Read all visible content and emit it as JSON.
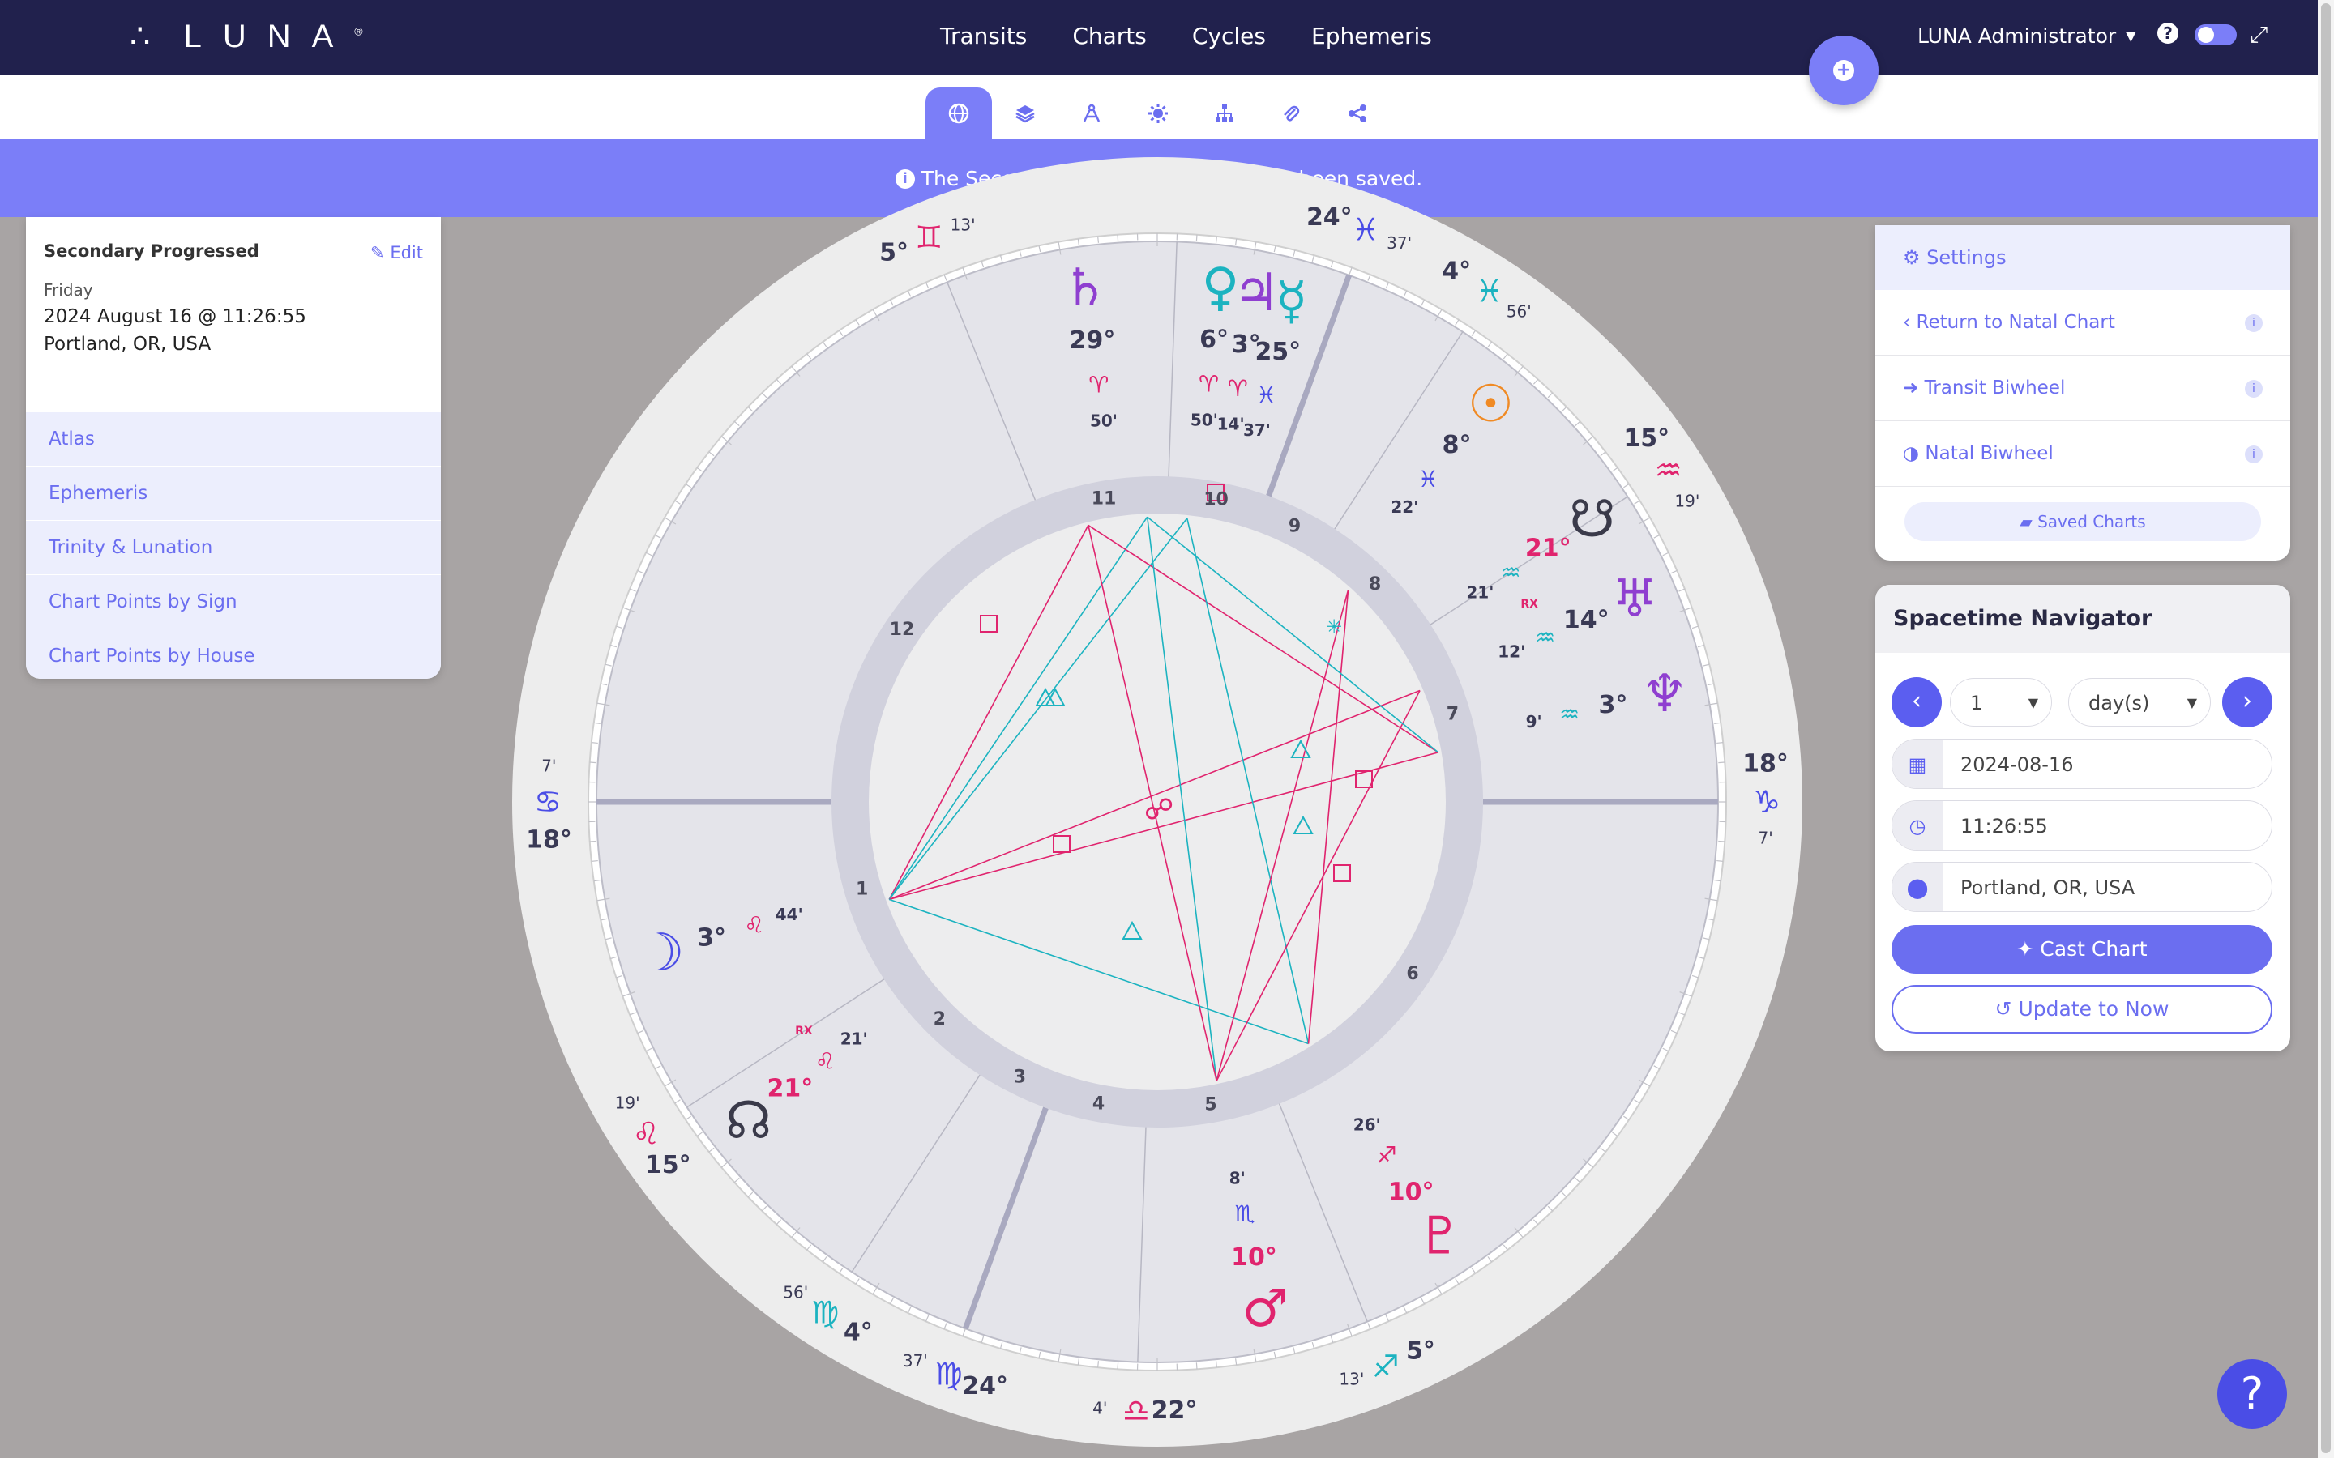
{
  "app": {
    "logo": "LUNA",
    "nav": [
      "Transits",
      "Charts",
      "Cycles",
      "Ephemeris"
    ],
    "user": "LUNA Administrator",
    "help_glyph": "?",
    "fab_glyph": "+"
  },
  "subtabs": [
    "globe-icon",
    "layers-icon",
    "compass-icon",
    "sun-icon",
    "hierarchy-icon",
    "paperclip-icon",
    "share-icon"
  ],
  "alert": {
    "icon": "i",
    "text": "The Secondary Progressed chart has been saved."
  },
  "left_panel": {
    "title": "Secondary Progressed",
    "edit": "Edit",
    "day": "Friday",
    "datetime": "2024 August 16 @ 11:26:55",
    "place": "Portland, OR, USA",
    "items": [
      "Atlas",
      "Ephemeris",
      "Trinity & Lunation",
      "Chart Points by Sign",
      "Chart Points by House"
    ]
  },
  "settings_panel": {
    "head": "Settings",
    "items": [
      "Return to Natal Chart",
      "Transit Biwheel",
      "Natal Biwheel"
    ],
    "saved": "Saved Charts"
  },
  "navigator": {
    "title": "Spacetime Navigator",
    "step": "1",
    "unit": "day(s)",
    "date": "2024-08-16",
    "time": "11:26:55",
    "place": "Portland, OR, USA",
    "cast": "Cast Chart",
    "update": "Update to Now",
    "help": "?"
  },
  "chart_wheel": {
    "house_numbers": [
      "1",
      "2",
      "3",
      "4",
      "5",
      "6",
      "7",
      "8",
      "9",
      "10",
      "11",
      "12"
    ],
    "cusps": [
      {
        "deg": "18°",
        "min": "7'",
        "glyph": "♋"
      },
      {
        "deg": "15°",
        "min": "19'",
        "glyph": "♌"
      },
      {
        "deg": "4°",
        "min": "56'",
        "glyph": "♍"
      },
      {
        "deg": "24°",
        "min": "37'",
        "glyph": "♍"
      },
      {
        "deg": "22°",
        "min": "4'",
        "glyph": "♎"
      },
      {
        "deg": "5°",
        "min": "13'",
        "glyph": "♐"
      },
      {
        "deg": "18°",
        "min": "7'",
        "glyph": "♑"
      },
      {
        "deg": "15°",
        "min": "19'",
        "glyph": "♒"
      },
      {
        "deg": "4°",
        "min": "56'",
        "glyph": "♓"
      },
      {
        "deg": "24°",
        "min": "37'",
        "glyph": "♓"
      },
      {
        "deg": "5°",
        "min": "13'",
        "glyph": "♊"
      }
    ],
    "planets": [
      {
        "name": "Saturn",
        "glyph": "♄",
        "deg": "29°",
        "sign": "♈",
        "min": "50'"
      },
      {
        "name": "Venus",
        "glyph": "♀",
        "deg": "6°",
        "sign": "♈",
        "min": "50'"
      },
      {
        "name": "Jupiter",
        "glyph": "♃",
        "deg": "3°",
        "sign": "♈",
        "min": "14'"
      },
      {
        "name": "Mercury",
        "glyph": "☿",
        "deg": "25°",
        "sign": "♓",
        "min": "37'"
      },
      {
        "name": "Sun",
        "glyph": "☉",
        "deg": "8°",
        "sign": "♓",
        "min": "22'"
      },
      {
        "name": "South Node",
        "glyph": "☋",
        "deg": "21°",
        "sign": "♒",
        "min": "21'",
        "rx": "RX"
      },
      {
        "name": "Uranus",
        "glyph": "♅",
        "deg": "14°",
        "sign": "♒",
        "min": "12'"
      },
      {
        "name": "Neptune",
        "glyph": "♆",
        "deg": "3°",
        "sign": "♒",
        "min": "9'"
      },
      {
        "name": "Pluto",
        "glyph": "♇",
        "deg": "10°",
        "sign": "♐",
        "min": "26'"
      },
      {
        "name": "Mars",
        "glyph": "♂",
        "deg": "10°",
        "sign": "♏",
        "min": "8'"
      },
      {
        "name": "North Node",
        "glyph": "☊",
        "deg": "21°",
        "sign": "♌",
        "min": "21'",
        "rx": "RX"
      },
      {
        "name": "Moon",
        "glyph": "☽",
        "deg": "3°",
        "sign": "♌",
        "min": "44'"
      }
    ],
    "colors": {
      "pink": "#e0246e",
      "teal": "#1cb3c0",
      "blue": "#4a4de6",
      "purple": "#8f3fd0",
      "orange": "#f08a24",
      "dark": "#3a3a4a"
    }
  }
}
